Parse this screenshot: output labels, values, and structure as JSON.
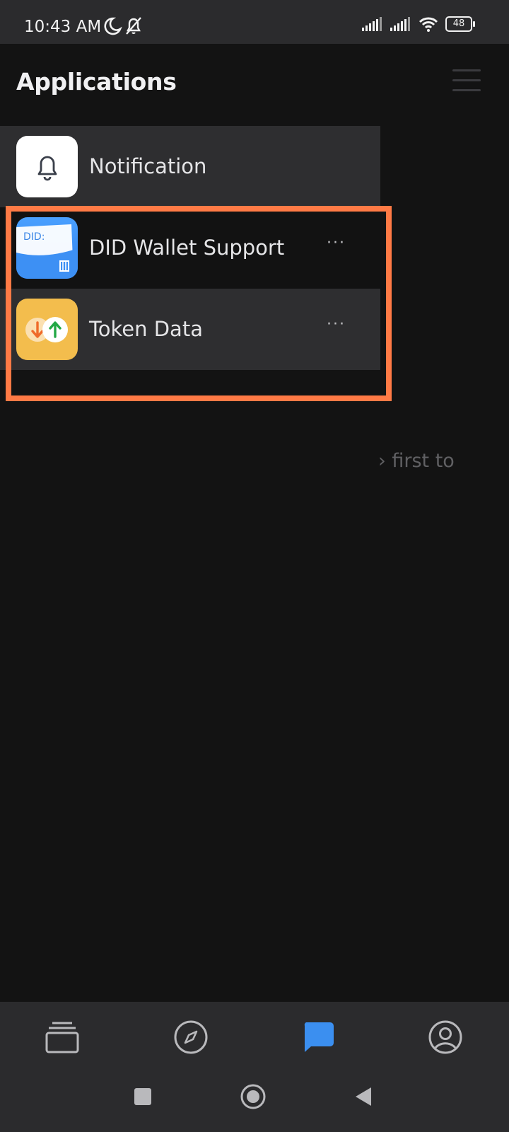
{
  "status_bar": {
    "time": "10:43 AM",
    "battery": "48",
    "icons": [
      "moon-icon",
      "bell-off-icon",
      "signal-icon",
      "signal-icon",
      "wifi-icon",
      "battery-icon"
    ]
  },
  "header": {
    "title": "Applications",
    "menu_icon": "hamburger-icon"
  },
  "apps": [
    {
      "label": "Notification",
      "icon": "bell-icon"
    },
    {
      "label": "DID Wallet Support",
      "icon": "did-wallet-icon",
      "icon_text": "DID:",
      "more": "···"
    },
    {
      "label": "Token Data",
      "icon": "token-arrows-icon",
      "more": "···"
    }
  ],
  "hint": "› first to",
  "bottom_nav": {
    "tabs": [
      {
        "name": "wallet-cards-icon"
      },
      {
        "name": "compass-icon"
      },
      {
        "name": "chat-icon",
        "active": true
      },
      {
        "name": "profile-icon"
      }
    ],
    "system": [
      "recents-square-icon",
      "home-circle-icon",
      "back-triangle-icon"
    ]
  },
  "colors": {
    "background": "#131313",
    "panel": "#2e2e30",
    "highlight": "#ff7a45",
    "accent": "#3b8ff0"
  }
}
